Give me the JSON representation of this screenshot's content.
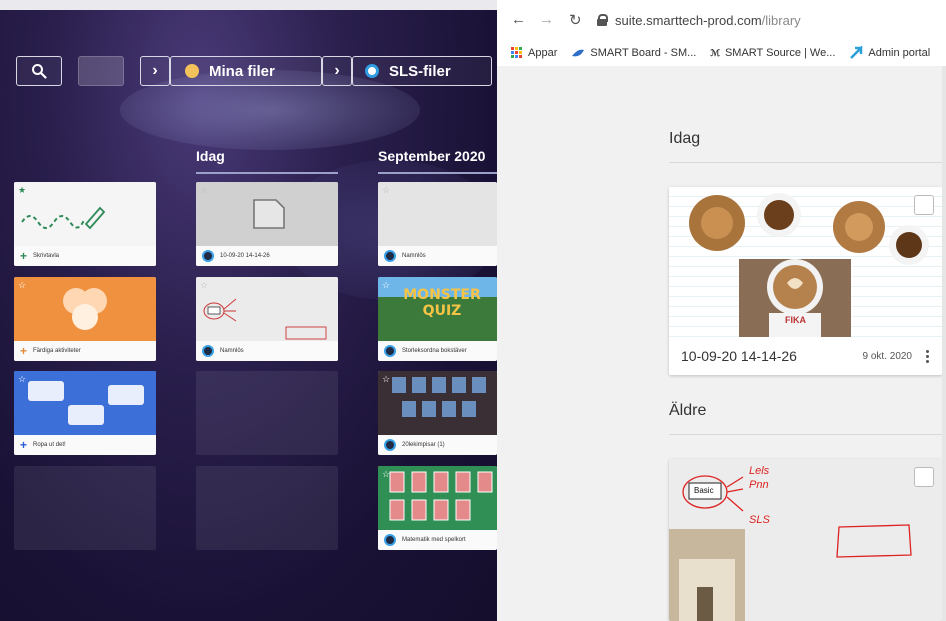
{
  "left": {
    "toolbar": {
      "mina_label": "Mina filer",
      "sls_label": "SLS-filer"
    },
    "columns": [
      {
        "heading": ""
      },
      {
        "heading": "Idag"
      },
      {
        "heading": "September 2020"
      }
    ],
    "tiles": {
      "skrivtavla": "Skrivtavla",
      "fardiga": "Färdiga aktiviteter",
      "ropa": "Ropa ut det!",
      "idag_file": "10-09-20 14-14-26",
      "namnlos_idag": "Namnlös",
      "sep_namnlos": "Namnlös",
      "storlek": "Storleksordna bokstäver",
      "lekspel": "20lekimpisar (1)",
      "matematik": "Matematik med spelkort",
      "monster_text": "MONSTER QUIZ"
    }
  },
  "browser": {
    "url_prefix": "suite.smarttech-prod.com",
    "url_path": "/library",
    "bookmarks": [
      {
        "label": "Appar",
        "icon": "apps-grid-icon"
      },
      {
        "label": "SMART Board - SM...",
        "icon": "smart-board-icon"
      },
      {
        "label": "SMART Source | We...",
        "icon": "smart-source-icon"
      },
      {
        "label": "Admin portal",
        "icon": "admin-portal-icon"
      }
    ],
    "sections": {
      "today": "Idag",
      "older": "Äldre"
    },
    "card1": {
      "name": "10-09-20 14-14-26",
      "date": "9 okt. 2020",
      "image_text": "FIKA"
    },
    "card2": {
      "labels": [
        "Basic",
        "Lels",
        "Pnn",
        "SLS"
      ]
    }
  },
  "colors": {
    "accent": "#2f9be0",
    "left_bg": "#1a1236",
    "browser_bg": "#f1f1f1"
  }
}
